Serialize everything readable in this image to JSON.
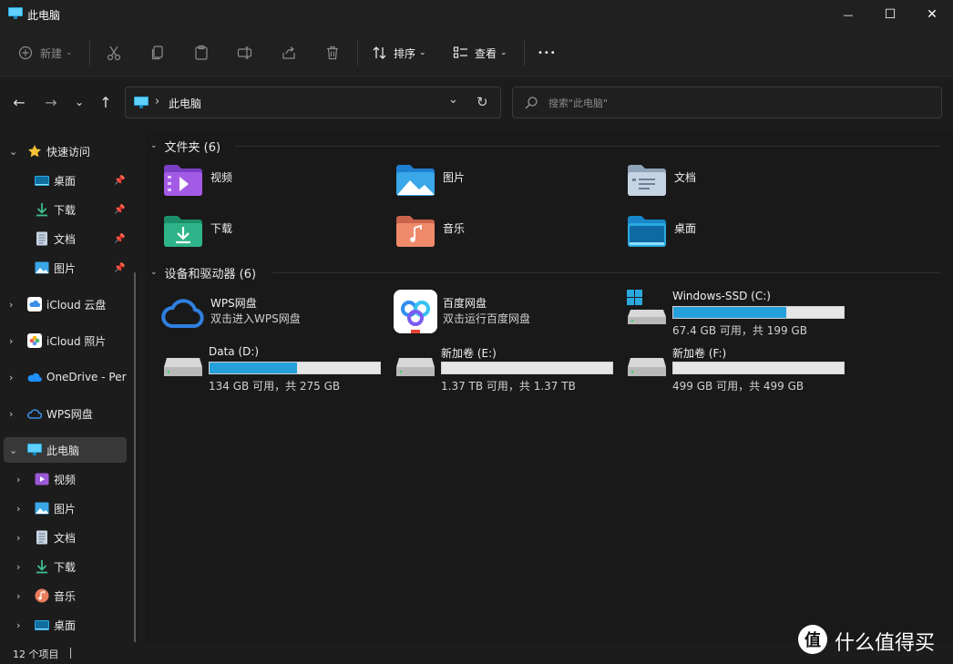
{
  "window": {
    "title": "此电脑",
    "minimize_glyph": "—",
    "maximize_glyph": "☐",
    "close_glyph": "✕"
  },
  "toolbar": {
    "new_label": "新建",
    "sort_label": "排序",
    "view_label": "查看",
    "more_glyph": "•••"
  },
  "address": {
    "path": "此电脑",
    "separator": "›"
  },
  "search": {
    "placeholder": "搜索\"此电脑\""
  },
  "sidebar": {
    "quick_access": "快速访问",
    "quick_items": [
      {
        "label": "桌面",
        "icon": "desktop-icon"
      },
      {
        "label": "下载",
        "icon": "download-icon"
      },
      {
        "label": "文档",
        "icon": "document-icon"
      },
      {
        "label": "图片",
        "icon": "picture-icon"
      }
    ],
    "roots": [
      {
        "label": "iCloud 云盘",
        "icon": "icloud-drive-icon"
      },
      {
        "label": "iCloud 照片",
        "icon": "icloud-photos-icon"
      },
      {
        "label": "OneDrive - Pers",
        "icon": "onedrive-icon"
      },
      {
        "label": "WPS网盘",
        "icon": "wps-cloud-icon"
      },
      {
        "label": "此电脑",
        "icon": "this-pc-icon"
      }
    ],
    "pc_children": [
      {
        "label": "视频",
        "icon": "video-icon"
      },
      {
        "label": "图片",
        "icon": "picture-icon"
      },
      {
        "label": "文档",
        "icon": "document-icon"
      },
      {
        "label": "下载",
        "icon": "download-icon"
      },
      {
        "label": "音乐",
        "icon": "music-icon"
      },
      {
        "label": "桌面",
        "icon": "desktop-icon"
      }
    ]
  },
  "folders_section": {
    "title": "文件夹 (6)",
    "items": [
      {
        "label": "视频",
        "icon": "video-folder-icon"
      },
      {
        "label": "图片",
        "icon": "pictures-folder-icon"
      },
      {
        "label": "文档",
        "icon": "documents-folder-icon"
      },
      {
        "label": "下载",
        "icon": "downloads-folder-icon"
      },
      {
        "label": "音乐",
        "icon": "music-folder-icon"
      },
      {
        "label": "桌面",
        "icon": "desktop-folder-icon"
      }
    ]
  },
  "devices_section": {
    "title": "设备和驱动器 (6)",
    "apps": [
      {
        "name": "WPS网盘",
        "sub": "双击进入WPS网盘",
        "icon": "wps-cloud-icon"
      },
      {
        "name": "百度网盘",
        "sub": "双击运行百度网盘",
        "icon": "baidu-netdisk-icon"
      }
    ],
    "drives": [
      {
        "name": "Windows-SSD (C:)",
        "free": "67.4 GB 可用，共 199 GB",
        "used_fraction": 0.661,
        "icon": "windows-drive-icon"
      },
      {
        "name": "Data (D:)",
        "free": "134 GB 可用，共 275 GB",
        "used_fraction": 0.513,
        "icon": "drive-icon"
      },
      {
        "name": "新加卷 (E:)",
        "free": "1.37 TB 可用，共 1.37 TB",
        "used_fraction": 0.0,
        "icon": "drive-icon"
      },
      {
        "name": "新加卷 (F:)",
        "free": "499 GB 可用，共 499 GB",
        "used_fraction": 0.0,
        "icon": "drive-icon"
      }
    ]
  },
  "status": {
    "item_count": "12 个项目"
  },
  "watermark": {
    "logo_glyph": "值",
    "text": "什么值得买"
  },
  "colors": {
    "accent": "#26a0da",
    "background": "#191919",
    "chrome": "#202020"
  }
}
